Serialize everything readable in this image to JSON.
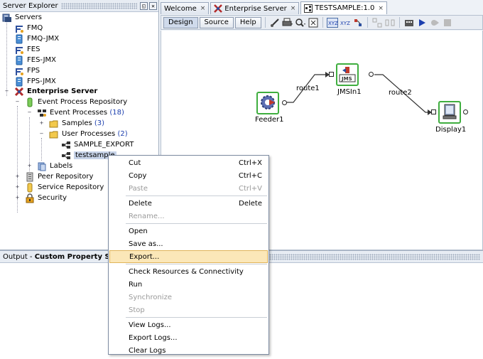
{
  "explorer": {
    "title": "Server Explorer",
    "restore_glyph": "◱",
    "close_glyph": "✕",
    "tree": {
      "servers": "Servers",
      "fmq": "FMQ",
      "fmq_jmx": "FMQ-JMX",
      "fes": "FES",
      "fes_jmx": "FES-JMX",
      "fps": "FPS",
      "fps_jmx": "FPS-JMX",
      "enterprise_server": "Enterprise Server",
      "event_process_repository": "Event Process Repository",
      "event_processes": "Event Processes",
      "event_processes_count": "(18)",
      "samples": "Samples",
      "samples_count": "(3)",
      "user_processes": "User Processes",
      "user_processes_count": "(2)",
      "sample_export": "SAMPLE_EXPORT",
      "testsample": "testsample",
      "labels": "Labels",
      "peer_repository": "Peer Repository",
      "service_repository": "Service Repository",
      "security": "Security"
    }
  },
  "output": {
    "prefix": "Output - ",
    "title": "Custom Property Sheet"
  },
  "tabs": [
    {
      "label": "Welcome",
      "close": "×"
    },
    {
      "label": "Enterprise Server",
      "close": "×"
    },
    {
      "label": "TESTSAMPLE:1.0",
      "close": "×"
    }
  ],
  "toolbar": {
    "design": "Design",
    "source": "Source",
    "help": "Help"
  },
  "canvas": {
    "nodes": {
      "feeder": "Feeder1",
      "jmsin": "JMSIn1",
      "display": "Display1",
      "jms_badge": "JMS"
    },
    "routes": {
      "route1": "route1",
      "route2": "route2"
    }
  },
  "context_menu": {
    "cut": "Cut",
    "cut_key": "Ctrl+X",
    "copy": "Copy",
    "copy_key": "Ctrl+C",
    "paste": "Paste",
    "paste_key": "Ctrl+V",
    "delete": "Delete",
    "delete_key": "Delete",
    "rename": "Rename...",
    "open": "Open",
    "save_as": "Save as...",
    "export": "Export...",
    "check_resources": "Check Resources & Connectivity",
    "run": "Run",
    "synchronize": "Synchronize",
    "stop": "Stop",
    "view_logs": "View Logs...",
    "export_logs": "Export Logs...",
    "clear_logs": "Clear Logs"
  },
  "colors": {
    "accent_green": "#3fae3f",
    "menu_highlight": "#fbe7b8",
    "count_blue": "#1c3fae"
  }
}
